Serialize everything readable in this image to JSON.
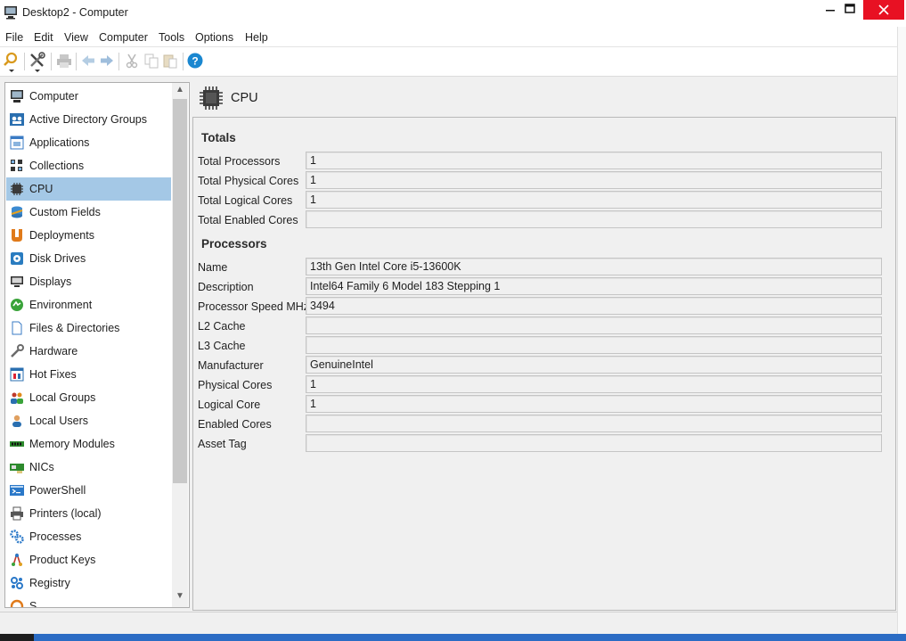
{
  "window": {
    "title": "Desktop2 - Computer"
  },
  "menu": [
    "File",
    "Edit",
    "View",
    "Computer",
    "Tools",
    "Options",
    "Help"
  ],
  "toolbar": [
    "search-icon",
    "tools-icon",
    "print-icon",
    "back-icon",
    "forward-icon",
    "cut-icon",
    "copy-icon",
    "paste-icon",
    "help-icon"
  ],
  "sidebar": {
    "selected": "CPU",
    "items": [
      {
        "label": "Computer",
        "icon": "computer-icon"
      },
      {
        "label": "Active Directory Groups",
        "icon": "ad-groups-icon"
      },
      {
        "label": "Applications",
        "icon": "applications-icon"
      },
      {
        "label": "Collections",
        "icon": "collections-icon"
      },
      {
        "label": "CPU",
        "icon": "cpu-icon"
      },
      {
        "label": "Custom Fields",
        "icon": "custom-fields-icon"
      },
      {
        "label": "Deployments",
        "icon": "deployments-icon"
      },
      {
        "label": "Disk Drives",
        "icon": "disk-drives-icon"
      },
      {
        "label": "Displays",
        "icon": "displays-icon"
      },
      {
        "label": "Environment",
        "icon": "environment-icon"
      },
      {
        "label": "Files & Directories",
        "icon": "files-icon"
      },
      {
        "label": "Hardware",
        "icon": "hardware-icon"
      },
      {
        "label": "Hot Fixes",
        "icon": "hot-fixes-icon"
      },
      {
        "label": "Local Groups",
        "icon": "local-groups-icon"
      },
      {
        "label": "Local Users",
        "icon": "local-users-icon"
      },
      {
        "label": "Memory Modules",
        "icon": "memory-icon"
      },
      {
        "label": "NICs",
        "icon": "nic-icon"
      },
      {
        "label": "PowerShell",
        "icon": "powershell-icon"
      },
      {
        "label": "Printers (local)",
        "icon": "printer-icon"
      },
      {
        "label": "Processes",
        "icon": "processes-icon"
      },
      {
        "label": "Product Keys",
        "icon": "product-keys-icon"
      },
      {
        "label": "Registry",
        "icon": "registry-icon"
      },
      {
        "label": "S",
        "icon": "partial-item-icon"
      }
    ]
  },
  "page": {
    "title": "CPU"
  },
  "totals": {
    "heading": "Totals",
    "rows": [
      {
        "label": "Total Processors",
        "value": "1"
      },
      {
        "label": "Total Physical Cores",
        "value": "1"
      },
      {
        "label": "Total Logical Cores",
        "value": "1"
      },
      {
        "label": "Total Enabled Cores",
        "value": ""
      }
    ]
  },
  "processors": {
    "heading": "Processors",
    "rows": [
      {
        "label": "Name",
        "value": "13th Gen Intel Core i5-13600K"
      },
      {
        "label": "Description",
        "value": "Intel64 Family 6 Model 183 Stepping 1"
      },
      {
        "label": "Processor Speed MHz",
        "value": "3494"
      },
      {
        "label": "L2 Cache",
        "value": ""
      },
      {
        "label": "L3 Cache",
        "value": ""
      },
      {
        "label": "Manufacturer",
        "value": "GenuineIntel"
      },
      {
        "label": "Physical Cores",
        "value": "1"
      },
      {
        "label": "Logical Core",
        "value": "1"
      },
      {
        "label": "Enabled Cores",
        "value": ""
      },
      {
        "label": "Asset Tag",
        "value": ""
      }
    ]
  },
  "colors": {
    "selection": "#a4c8e6",
    "close_button": "#e81123",
    "help": "#1a87d0"
  }
}
